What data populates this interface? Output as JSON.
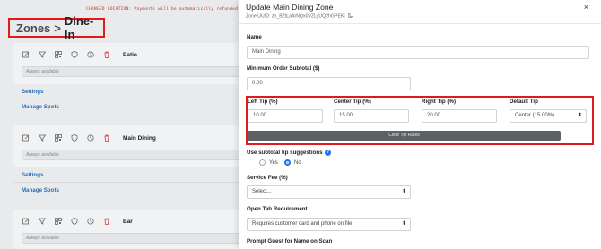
{
  "background": {
    "warning": "CHANGED LOCATION: Payments will be automatically refunded",
    "breadcrumb": {
      "parent": "Zones",
      "separator": ">",
      "current": "Dine-In"
    },
    "zones": [
      {
        "name": "Patio",
        "availability": "Always available",
        "settings_label": "Settings",
        "spots_label": "Manage Spots"
      },
      {
        "name": "Main Dining",
        "availability": "Always available",
        "settings_label": "Settings",
        "spots_label": "Manage Spots"
      },
      {
        "name": "Bar",
        "availability": "Always available"
      }
    ]
  },
  "modal": {
    "title": "Update Main Dining Zone",
    "close": "×",
    "uuid_text": "Zone UUID: zn_BZtLaArNQx0VZLyUQ2hGPEKi",
    "name": {
      "label": "Name",
      "value": "Main Dining"
    },
    "min_order": {
      "label": "Minimum Order Subtotal ($)",
      "value": "0.00"
    },
    "tips": {
      "left_label": "Left Tip (%)",
      "left_value": "10.00",
      "center_label": "Center Tip (%)",
      "center_value": "15.00",
      "right_label": "Right Tip (%)",
      "right_value": "20.00",
      "default_label": "Default Tip",
      "default_value": "Center (15.00%)",
      "clear_button": "Clear Tip Rates"
    },
    "subtotal_tip": {
      "label": "Use subtotal tip suggestions",
      "yes": "Yes",
      "no": "No",
      "selected": "No"
    },
    "service_fee": {
      "label": "Service Fee (%)",
      "value": "Select..."
    },
    "open_tab": {
      "label": "Open Tab Requirement",
      "value": "Requires customer card and phone on file."
    },
    "prompt_guest": {
      "label": "Prompt Guest for Name on Scan"
    }
  },
  "colors": {
    "highlight": "#e0191b",
    "link": "#2c6fb3",
    "radio": "#1a73e8",
    "button": "#5d6166"
  }
}
